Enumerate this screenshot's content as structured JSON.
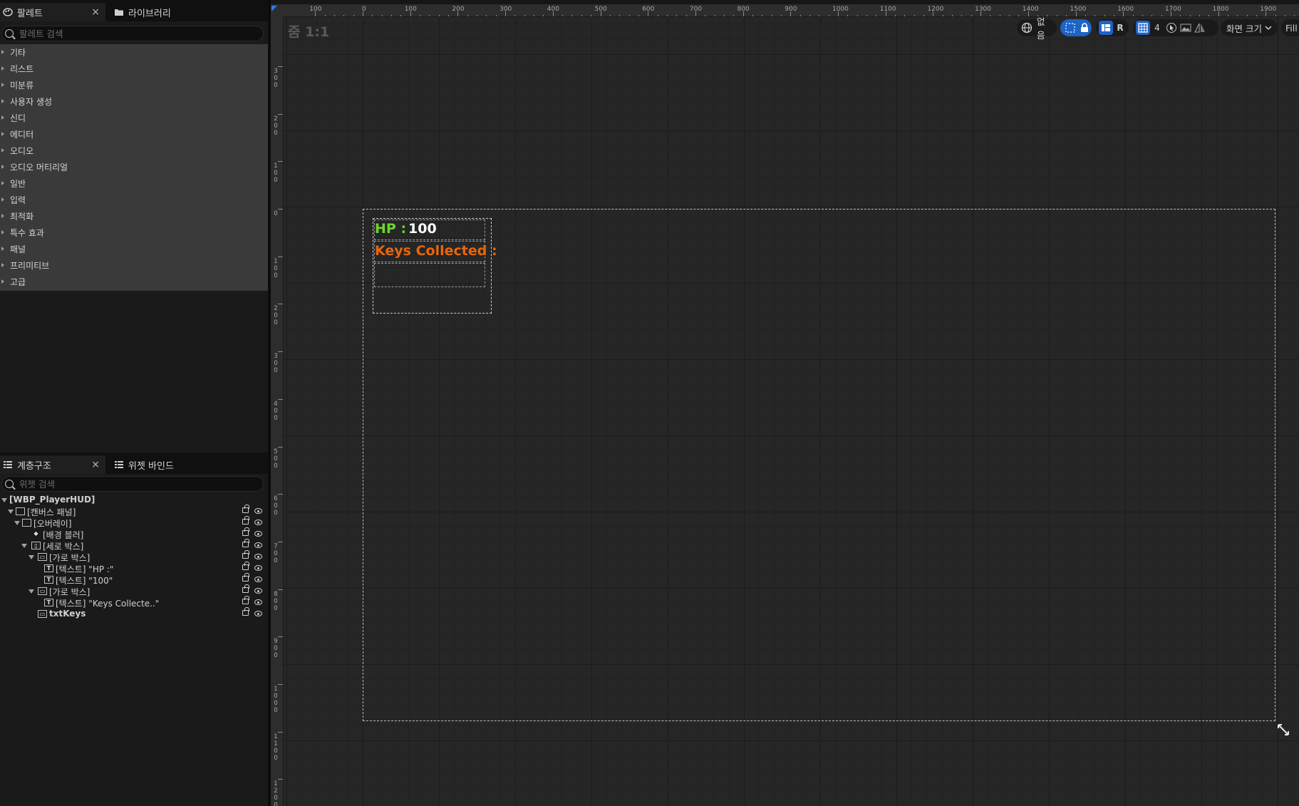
{
  "palette": {
    "tab_label": "팔레트",
    "library_tab_label": "라이브러리",
    "close_glyph": "×",
    "search_placeholder": "팔레트 검색",
    "categories": [
      "기타",
      "리스트",
      "미분류",
      "사용자 생성",
      "신디",
      "에디터",
      "오디오",
      "오디오 머티리얼",
      "일반",
      "입력",
      "최적화",
      "특수 효과",
      "패널",
      "프리미티브",
      "고급"
    ]
  },
  "hierarchy": {
    "tab_label": "계층구조",
    "bindings_tab_label": "위젯 바인드",
    "close_glyph": "×",
    "search_placeholder": "위젯 검색",
    "root": "[WBP_PlayerHUD]",
    "nodes": [
      {
        "label": "[캔버스 패널]",
        "icon": "canvas-icon"
      },
      {
        "label": "[오버레이]",
        "icon": "overlay-icon"
      },
      {
        "label": "[배경 블러]",
        "icon": "blur-icon"
      },
      {
        "label": "[세로 박스]",
        "icon": "vbox-icon"
      },
      {
        "label": "[가로 박스]",
        "icon": "hbox-icon"
      },
      {
        "label": "[텍스트] \"HP :\"",
        "icon": "text-icon"
      },
      {
        "label": "[텍스트] \"100\"",
        "icon": "text-icon"
      },
      {
        "label": "[가로 박스]",
        "icon": "hbox-icon"
      },
      {
        "label": "[텍스트] \"Keys Collecte..\"",
        "icon": "text-icon"
      },
      {
        "label": "txtKeys",
        "icon": "textbox-icon"
      }
    ]
  },
  "canvas": {
    "zoom_label": "줌 1:1",
    "hruler_labels": [
      "100",
      "0",
      "100",
      "200",
      "300",
      "400",
      "500",
      "600",
      "700",
      "800",
      "900",
      "1000",
      "1100",
      "1200",
      "1300",
      "1400",
      "1500",
      "1600",
      "1700",
      "1800",
      "1900"
    ],
    "vruler_labels": [
      "300",
      "200",
      "100",
      "0",
      "100",
      "200",
      "300",
      "400",
      "500",
      "600",
      "700",
      "800",
      "900",
      "1000",
      "1100",
      "1200"
    ],
    "toolbar": {
      "localization": "없음",
      "respect_lock_letter": "R",
      "grid_size": "4",
      "screen_size": "화면 크기",
      "fill_mode": "Fill S"
    },
    "hud": {
      "hp_label": "HP :",
      "hp_value": "100",
      "keys_label": "Keys Collected :",
      "hp_color": "#6bd62f",
      "keys_color": "#e8660a"
    }
  }
}
